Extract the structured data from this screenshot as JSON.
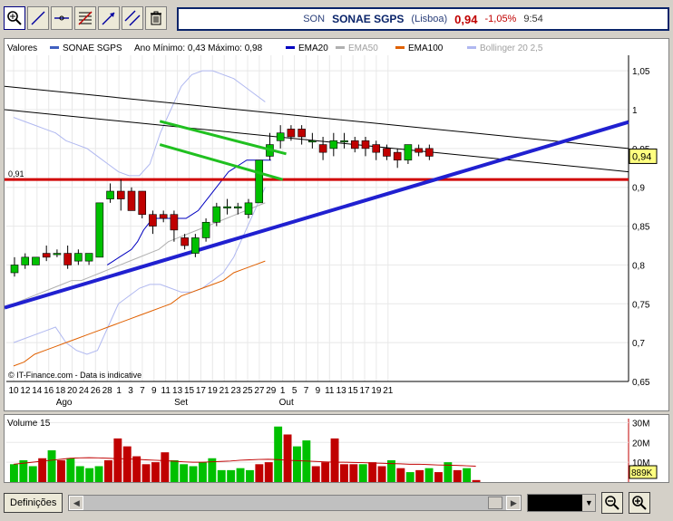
{
  "toolbar": {
    "icons": [
      "zoom-in-icon",
      "draw-line-icon",
      "horizontal-line-icon",
      "fibonacci-icon",
      "trend-arrow-icon",
      "parallel-lines-icon",
      "trash-icon"
    ]
  },
  "quote": {
    "symbol": "SON",
    "name": "SONAE SGPS",
    "exchange": "(Lisboa)",
    "price": "0,94",
    "change": "-1,05%",
    "time": "9:54"
  },
  "legend": {
    "valores": "Valores",
    "series_name": "SONAE SGPS",
    "range": "Ano Mínimo: 0,43 Máximo: 0,98",
    "ema20": "EMA20",
    "ema50": "EMA50",
    "ema100": "EMA100",
    "bollinger": "Bollinger 20 2,5"
  },
  "colors": {
    "up": "#00c000",
    "down": "#c00000",
    "ema20": "#0000c0",
    "ema50": "#b0b0b0",
    "ema100": "#e06000",
    "bollinger": "#b0b8f0",
    "trend": "#2020d0",
    "channel": "#20c020",
    "support": "#d00000",
    "price_tag": "#ffff80"
  },
  "chart_data": {
    "type": "candlestick",
    "ylim": [
      0.65,
      1.07
    ],
    "y_ticks": [
      "1,05",
      "1",
      "0,95",
      "0,9",
      "0,85",
      "0,8",
      "0,75",
      "0,7",
      "0,65"
    ],
    "x_ticks": [
      "10",
      "12",
      "14",
      "16",
      "18",
      "20",
      "24",
      "26",
      "28",
      "1",
      "3",
      "7",
      "9",
      "11",
      "13",
      "15",
      "17",
      "19",
      "21",
      "23",
      "25",
      "27",
      "29",
      "1",
      "5",
      "7",
      "9",
      "11",
      "13",
      "15",
      "17",
      "19",
      "21"
    ],
    "month_labels": [
      "Ago",
      "Set",
      "Out"
    ],
    "current_price": "0,94",
    "support_level": 0.91,
    "support_label": "0,91",
    "credit": "© IT-Finance.com - Data is indicative",
    "candles": [
      {
        "o": 0.79,
        "c": 0.8,
        "h": 0.81,
        "l": 0.785
      },
      {
        "o": 0.8,
        "c": 0.81,
        "h": 0.815,
        "l": 0.795
      },
      {
        "o": 0.8,
        "c": 0.81,
        "h": 0.81,
        "l": 0.8
      },
      {
        "o": 0.815,
        "c": 0.81,
        "h": 0.825,
        "l": 0.805
      },
      {
        "o": 0.815,
        "c": 0.815,
        "h": 0.82,
        "l": 0.81
      },
      {
        "o": 0.815,
        "c": 0.8,
        "h": 0.825,
        "l": 0.795
      },
      {
        "o": 0.805,
        "c": 0.815,
        "h": 0.82,
        "l": 0.8
      },
      {
        "o": 0.805,
        "c": 0.815,
        "h": 0.815,
        "l": 0.8
      },
      {
        "o": 0.81,
        "c": 0.88,
        "h": 0.88,
        "l": 0.81
      },
      {
        "o": 0.885,
        "c": 0.895,
        "h": 0.905,
        "l": 0.88
      },
      {
        "o": 0.895,
        "c": 0.885,
        "h": 0.91,
        "l": 0.87
      },
      {
        "o": 0.895,
        "c": 0.87,
        "h": 0.9,
        "l": 0.87
      },
      {
        "o": 0.895,
        "c": 0.865,
        "h": 0.895,
        "l": 0.86
      },
      {
        "o": 0.865,
        "c": 0.85,
        "h": 0.87,
        "l": 0.84
      },
      {
        "o": 0.865,
        "c": 0.86,
        "h": 0.87,
        "l": 0.855
      },
      {
        "o": 0.865,
        "c": 0.845,
        "h": 0.87,
        "l": 0.83
      },
      {
        "o": 0.835,
        "c": 0.825,
        "h": 0.84,
        "l": 0.82
      },
      {
        "o": 0.815,
        "c": 0.835,
        "h": 0.84,
        "l": 0.81
      },
      {
        "o": 0.835,
        "c": 0.855,
        "h": 0.86,
        "l": 0.83
      },
      {
        "o": 0.855,
        "c": 0.875,
        "h": 0.88,
        "l": 0.85
      },
      {
        "o": 0.875,
        "c": 0.875,
        "h": 0.885,
        "l": 0.865
      },
      {
        "o": 0.875,
        "c": 0.875,
        "h": 0.88,
        "l": 0.865
      },
      {
        "o": 0.865,
        "c": 0.88,
        "h": 0.885,
        "l": 0.86
      },
      {
        "o": 0.88,
        "c": 0.935,
        "h": 0.935,
        "l": 0.88
      },
      {
        "o": 0.94,
        "c": 0.955,
        "h": 0.97,
        "l": 0.935
      },
      {
        "o": 0.96,
        "c": 0.97,
        "h": 0.98,
        "l": 0.95
      },
      {
        "o": 0.975,
        "c": 0.965,
        "h": 0.98,
        "l": 0.96
      },
      {
        "o": 0.975,
        "c": 0.965,
        "h": 0.98,
        "l": 0.955
      },
      {
        "o": 0.96,
        "c": 0.96,
        "h": 0.97,
        "l": 0.95
      },
      {
        "o": 0.955,
        "c": 0.945,
        "h": 0.965,
        "l": 0.935
      },
      {
        "o": 0.95,
        "c": 0.96,
        "h": 0.97,
        "l": 0.94
      },
      {
        "o": 0.96,
        "c": 0.96,
        "h": 0.97,
        "l": 0.95
      },
      {
        "o": 0.96,
        "c": 0.95,
        "h": 0.965,
        "l": 0.945
      },
      {
        "o": 0.96,
        "c": 0.95,
        "h": 0.965,
        "l": 0.94
      },
      {
        "o": 0.955,
        "c": 0.945,
        "h": 0.96,
        "l": 0.935
      },
      {
        "o": 0.95,
        "c": 0.94,
        "h": 0.955,
        "l": 0.935
      },
      {
        "o": 0.945,
        "c": 0.935,
        "h": 0.95,
        "l": 0.925
      },
      {
        "o": 0.935,
        "c": 0.955,
        "h": 0.955,
        "l": 0.93
      },
      {
        "o": 0.95,
        "c": 0.945,
        "h": 0.955,
        "l": 0.94
      },
      {
        "o": 0.95,
        "c": 0.94,
        "h": 0.955,
        "l": 0.935
      }
    ],
    "ema20": [
      0.8,
      0.805,
      0.81,
      0.815,
      0.82,
      0.83,
      0.845,
      0.855,
      0.86,
      0.86,
      0.86,
      0.86,
      0.86,
      0.86,
      0.865,
      0.87,
      0.88,
      0.89,
      0.9,
      0.91,
      0.92,
      0.925,
      0.93,
      0.935,
      0.935,
      0.935,
      0.935,
      0.935
    ],
    "ema50": [
      0.75,
      0.755,
      0.76,
      0.765,
      0.77,
      0.775,
      0.78,
      0.78,
      0.785,
      0.79,
      0.795,
      0.8,
      0.805,
      0.81,
      0.815,
      0.82,
      0.83,
      0.835,
      0.84,
      0.845,
      0.85,
      0.855,
      0.86,
      0.865,
      0.87,
      0.875,
      0.88
    ],
    "ema100": [
      0.67,
      0.675,
      0.685,
      0.69,
      0.695,
      0.7,
      0.705,
      0.71,
      0.715,
      0.72,
      0.725,
      0.73,
      0.735,
      0.74,
      0.745,
      0.75,
      0.76,
      0.765,
      0.77,
      0.775,
      0.78,
      0.79,
      0.795,
      0.8,
      0.805
    ],
    "boll_upper": [
      0.99,
      0.985,
      0.98,
      0.975,
      0.97,
      0.96,
      0.955,
      0.95,
      0.94,
      0.93,
      0.92,
      0.915,
      0.915,
      0.93,
      0.97,
      1.0,
      1.03,
      1.045,
      1.05,
      1.05,
      1.045,
      1.04,
      1.03,
      1.02,
      1.01
    ],
    "boll_lower": [
      0.7,
      0.705,
      0.71,
      0.715,
      0.72,
      0.7,
      0.69,
      0.685,
      0.69,
      0.72,
      0.75,
      0.76,
      0.77,
      0.775,
      0.775,
      0.77,
      0.765,
      0.765,
      0.77,
      0.78,
      0.79,
      0.81,
      0.84,
      0.87,
      0.9
    ],
    "volume": {
      "title": "Volume 15",
      "ticks": [
        "30M",
        "20M",
        "10M"
      ],
      "last_label": "889K",
      "ylim": [
        0,
        32
      ],
      "bars": [
        9,
        11,
        8,
        12,
        16,
        11,
        12,
        8,
        7,
        8,
        11,
        22,
        18,
        13,
        9,
        10,
        15,
        11,
        9,
        8,
        10,
        12,
        6,
        6,
        7,
        6,
        9,
        10,
        28,
        24,
        18,
        21,
        8,
        10,
        22,
        9,
        9,
        9,
        10,
        8,
        11,
        7,
        5,
        6,
        7,
        5,
        10,
        6,
        7,
        1
      ],
      "ma": [
        9,
        9.5,
        10,
        10.5,
        11,
        11.5,
        12,
        12.2,
        12.3,
        12.2,
        12,
        11.8,
        11.7,
        11.5,
        11.2,
        11,
        10.8,
        10.5,
        10.2,
        10,
        10,
        10.2,
        10.4,
        10.6,
        11,
        11.2,
        11.4,
        11.5,
        11.3,
        11,
        10.8,
        10.6,
        10.4,
        10.2,
        10,
        10,
        9.9,
        9.8,
        9.6,
        9.5,
        9.3,
        9.2,
        9,
        9,
        8.8,
        8.6,
        8.5,
        8.4,
        8.2,
        8
      ]
    }
  },
  "bottom": {
    "definitions": "Definições"
  }
}
